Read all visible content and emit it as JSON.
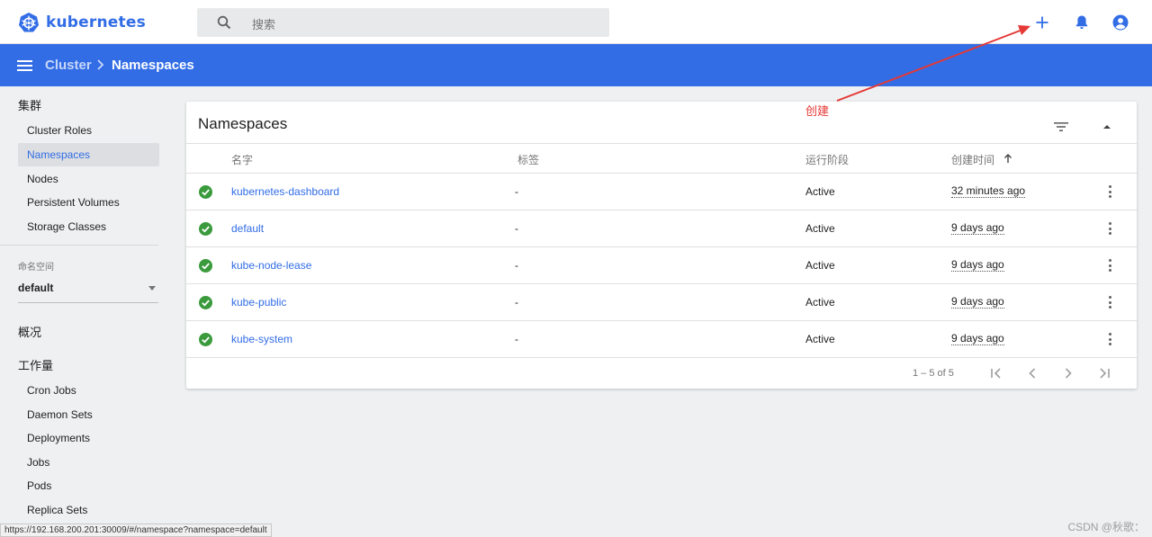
{
  "header": {
    "brand": "kubernetes",
    "search_placeholder": "搜索"
  },
  "breadcrumb": {
    "parent": "Cluster",
    "current": "Namespaces"
  },
  "sidebar": {
    "cluster_heading": "集群",
    "cluster_items": [
      {
        "label": "Cluster Roles"
      },
      {
        "label": "Namespaces"
      },
      {
        "label": "Nodes"
      },
      {
        "label": "Persistent Volumes"
      },
      {
        "label": "Storage Classes"
      }
    ],
    "namespace_heading": "命名空间",
    "namespace_selected": "default",
    "overview": "概况",
    "workloads_heading": "工作量",
    "workload_items": [
      {
        "label": "Cron Jobs"
      },
      {
        "label": "Daemon Sets"
      },
      {
        "label": "Deployments"
      },
      {
        "label": "Jobs"
      },
      {
        "label": "Pods"
      },
      {
        "label": "Replica Sets"
      }
    ]
  },
  "card": {
    "title": "Namespaces",
    "columns": {
      "name": "名字",
      "labels": "标签",
      "phase": "运行阶段",
      "created": "创建时间"
    },
    "rows": [
      {
        "name": "kubernetes-dashboard",
        "labels": "-",
        "phase": "Active",
        "created": "32 minutes ago"
      },
      {
        "name": "default",
        "labels": "-",
        "phase": "Active",
        "created": "9 days ago"
      },
      {
        "name": "kube-node-lease",
        "labels": "-",
        "phase": "Active",
        "created": "9 days ago"
      },
      {
        "name": "kube-public",
        "labels": "-",
        "phase": "Active",
        "created": "9 days ago"
      },
      {
        "name": "kube-system",
        "labels": "-",
        "phase": "Active",
        "created": "9 days ago"
      }
    ],
    "pagination": "1 – 5 of 5"
  },
  "annotation": {
    "text": "创建",
    "color": "#e53935"
  },
  "status_url": "https://192.168.200.201:30009/#/namespace?namespace=default",
  "watermark": "CSDN @秋歌：",
  "colors": {
    "brand": "#326de6",
    "status_ok": "#3a9a3c"
  }
}
